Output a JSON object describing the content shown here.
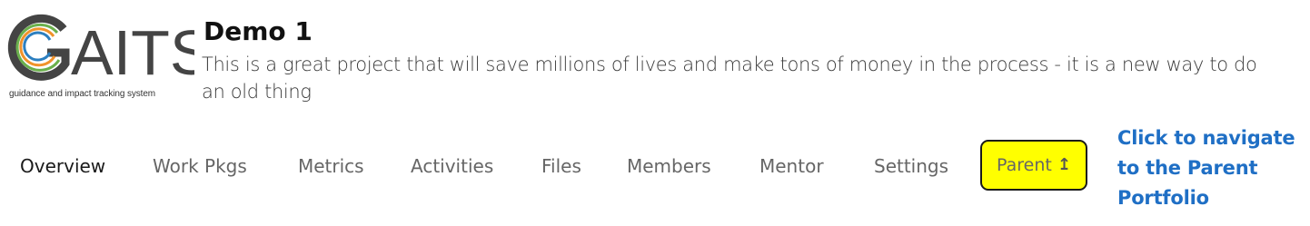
{
  "logo": {
    "wordmark": "GAITS",
    "tagline": "guidance and impact tracking system",
    "colors": {
      "mark_dark": "#444444",
      "ring_green": "#6ab04c",
      "ring_orange": "#f0932b",
      "ring_blue": "#2c7fc0"
    }
  },
  "project": {
    "title": "Demo 1",
    "description": "This is a great project that will save millions of lives and make tons of money in the process - it is a new way to do an old thing"
  },
  "nav": {
    "tabs": [
      {
        "label": "Overview",
        "active": true
      },
      {
        "label": "Work Pkgs"
      },
      {
        "label": "Metrics"
      },
      {
        "label": "Activities"
      },
      {
        "label": "Files"
      },
      {
        "label": "Members"
      },
      {
        "label": "Mentor"
      },
      {
        "label": "Settings"
      }
    ],
    "parent": {
      "label": "Parent",
      "icon": "arrow-up-icon",
      "highlight_color": "#ffff00"
    }
  },
  "callout": {
    "text": "Click to navigate to the Parent Portfolio",
    "color": "#1f6fc5"
  }
}
